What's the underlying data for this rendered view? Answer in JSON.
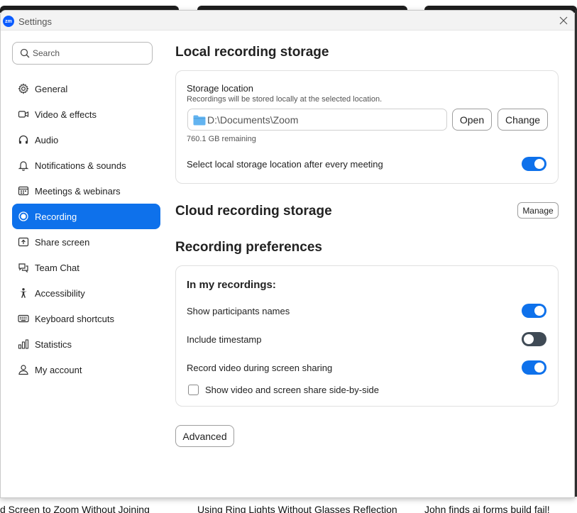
{
  "window": {
    "title": "Settings",
    "logo_text": "zm"
  },
  "search": {
    "placeholder": "Search"
  },
  "sidebar": {
    "items": [
      {
        "label": "General",
        "icon": "gear-icon"
      },
      {
        "label": "Video & effects",
        "icon": "video-camera-icon"
      },
      {
        "label": "Audio",
        "icon": "headphones-icon"
      },
      {
        "label": "Notifications & sounds",
        "icon": "bell-icon"
      },
      {
        "label": "Meetings & webinars",
        "icon": "calendar-grid-icon"
      },
      {
        "label": "Recording",
        "icon": "record-icon",
        "active": true
      },
      {
        "label": "Share screen",
        "icon": "share-screen-icon"
      },
      {
        "label": "Team Chat",
        "icon": "chat-bubble-icon"
      },
      {
        "label": "Accessibility",
        "icon": "accessibility-icon"
      },
      {
        "label": "Keyboard shortcuts",
        "icon": "keyboard-icon"
      },
      {
        "label": "Statistics",
        "icon": "bar-chart-icon"
      },
      {
        "label": "My account",
        "icon": "user-icon"
      }
    ]
  },
  "local": {
    "heading": "Local recording storage",
    "storage_label": "Storage location",
    "storage_desc": "Recordings will be stored locally at the selected location.",
    "path": "D:\\Documents\\Zoom",
    "open_label": "Open",
    "change_label": "Change",
    "remaining": "760.1 GB remaining",
    "select_after_label": "Select local storage location after every meeting",
    "select_after_on": true
  },
  "cloud": {
    "heading": "Cloud recording storage",
    "manage_label": "Manage"
  },
  "prefs": {
    "heading": "Recording preferences",
    "subheading": "In my recordings:",
    "show_names_label": "Show participants names",
    "show_names_on": true,
    "timestamp_label": "Include timestamp",
    "timestamp_on": false,
    "record_video_label": "Record video during screen sharing",
    "record_video_on": true,
    "side_by_side_label": "Show video and screen share side-by-side",
    "side_by_side_checked": false
  },
  "advanced_label": "Advanced",
  "background": {
    "captions": [
      "d Screen to Zoom Without Joining",
      "Using Ring Lights Without Glasses Reflection",
      "John finds ai forms build fail!"
    ]
  },
  "colors": {
    "accent": "#0e71eb",
    "toggle_off": "#3f4a55"
  }
}
